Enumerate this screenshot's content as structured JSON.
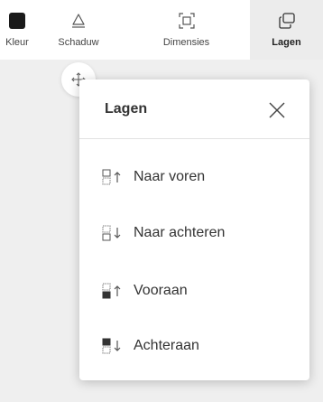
{
  "toolbar": {
    "items": [
      {
        "label": "Kleur",
        "icon": "color-swatch-icon",
        "color": "#1a1a1a"
      },
      {
        "label": "Schaduw",
        "icon": "shadow-icon"
      },
      {
        "label": "Dimensies",
        "icon": "dimensions-icon"
      },
      {
        "label": "Lagen",
        "icon": "layers-icon",
        "active": true
      }
    ]
  },
  "move_handle": {
    "icon": "move-icon"
  },
  "panel": {
    "title": "Lagen",
    "close_icon": "close-icon",
    "items": [
      {
        "label": "Naar voren",
        "icon": "bring-forward-icon"
      },
      {
        "label": "Naar achteren",
        "icon": "send-backward-icon"
      },
      {
        "label": "Vooraan",
        "icon": "bring-to-front-icon"
      },
      {
        "label": "Achteraan",
        "icon": "send-to-back-icon"
      }
    ]
  },
  "colors": {
    "background": "#efefef",
    "surface": "#ffffff",
    "active_tab": "#ececec",
    "text": "#333333",
    "swatch": "#1a1a1a"
  }
}
